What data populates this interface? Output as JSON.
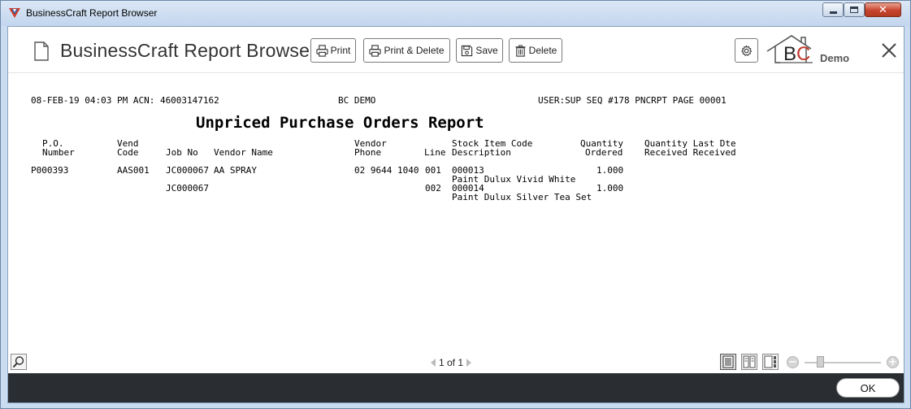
{
  "window": {
    "title": "BusinessCraft Report Browser"
  },
  "header": {
    "title": "BusinessCraft Report Browser",
    "buttons": {
      "print": "Print",
      "print_delete": "Print & Delete",
      "save": "Save",
      "delete": "Delete"
    },
    "logo_text_b": "B",
    "logo_text_c": "C",
    "demo_label": "Demo"
  },
  "report": {
    "header_left": "08-FEB-19 04:03 PM ACN: 46003147162",
    "header_center": "BC DEMO",
    "header_right": "USER:SUP SEQ #178 PNCRPT PAGE 00001",
    "title": "Unpriced Purchase Orders Report",
    "columns": {
      "po_1": "P.O.",
      "po_2": "Number",
      "vend_1": "Vend",
      "vend_2": "Code",
      "jobno": "Job No",
      "vendor_name": "Vendor Name",
      "vphone_1": "Vendor",
      "vphone_2": "Phone",
      "line": "Line",
      "stock_1": "Stock Item Code",
      "stock_2": "Description",
      "qty_1": "Quantity",
      "qty_2": "Ordered",
      "qrec_1": "Quantity Last Dte",
      "qrec_2": "Received Received"
    },
    "rows": [
      {
        "po": "P000393",
        "vend": "AAS001",
        "job": "JC000067",
        "vendor_name": "AA SPRAY",
        "phone": "02 9644 1040",
        "line": "001",
        "item_code": "000013",
        "description": "Paint Dulux Vivid White",
        "qty": "1.000"
      },
      {
        "job": "JC000067",
        "line": "002",
        "item_code": "000014",
        "description": "Paint Dulux Silver Tea Set",
        "qty": "1.000"
      }
    ]
  },
  "pager": {
    "text": "1 of 1"
  },
  "footer": {
    "ok_label": "OK"
  },
  "icons": {
    "app": "businesscraft-app-icon",
    "document": "document-icon",
    "print": "printer-icon",
    "save": "floppy-disk-icon",
    "delete": "trash-icon",
    "settings": "gear-icon",
    "close": "close-x-icon",
    "search": "magnifier-icon"
  },
  "colors": {
    "bottom_bar": "#2a2d31",
    "logo_c": "#c0392b",
    "titlebar_close": "#c7442e"
  }
}
